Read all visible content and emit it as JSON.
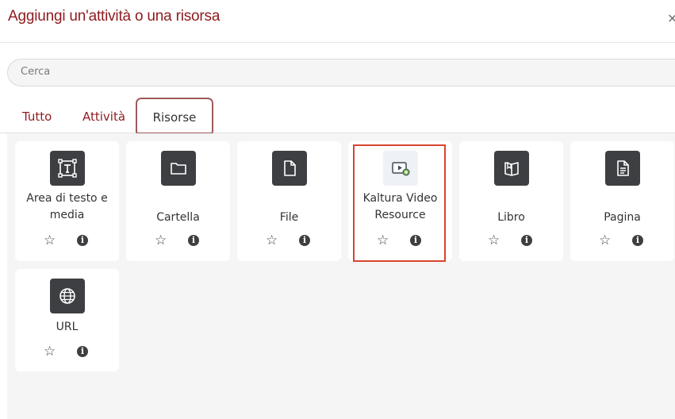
{
  "dialog": {
    "title": "Aggiungi un'attività o una risorsa",
    "close_glyph": "×"
  },
  "search": {
    "placeholder": "Cerca",
    "value": ""
  },
  "tabs": [
    {
      "label": "Tutto",
      "active": false
    },
    {
      "label": "Attività",
      "active": false
    },
    {
      "label": "Risorse",
      "active": true
    }
  ],
  "resources": [
    {
      "label": "Area di testo e media",
      "icon": "text-area-icon"
    },
    {
      "label": "Cartella",
      "icon": "folder-icon"
    },
    {
      "label": "File",
      "icon": "file-icon"
    },
    {
      "label": "Kaltura Video Resource",
      "icon": "kaltura-video-icon"
    },
    {
      "label": "Libro",
      "icon": "book-icon"
    },
    {
      "label": "Pagina",
      "icon": "page-icon"
    },
    {
      "label": "URL",
      "icon": "globe-icon"
    }
  ],
  "card_actions": {
    "star_glyph": "☆",
    "info_glyph": "i"
  },
  "colors": {
    "brand": "#8f1d21",
    "icon_bg": "#3d3f42",
    "highlight": "#d9442f"
  }
}
